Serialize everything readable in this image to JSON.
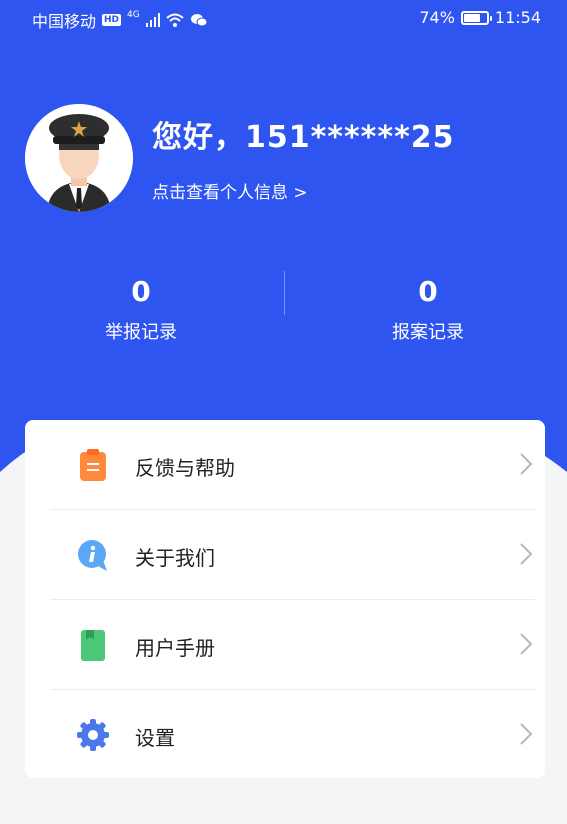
{
  "colors": {
    "primary": "#2f55f0",
    "page_bg": "#f4f5f7"
  },
  "status_bar": {
    "carrier": "中国移动",
    "network": "4G",
    "battery": "74%",
    "battery_level": 0.74,
    "time": "11:54"
  },
  "profile": {
    "greeting": "您好，151******25",
    "view_info": "点击查看个人信息 >"
  },
  "stats": [
    {
      "value": "0",
      "label": "举报记录"
    },
    {
      "value": "0",
      "label": "报案记录"
    }
  ],
  "menu": [
    {
      "label": "反馈与帮助",
      "icon": "clipboard-icon"
    },
    {
      "label": "关于我们",
      "icon": "info-bubble-icon"
    },
    {
      "label": "用户手册",
      "icon": "book-icon"
    },
    {
      "label": "设置",
      "icon": "gear-icon"
    }
  ]
}
